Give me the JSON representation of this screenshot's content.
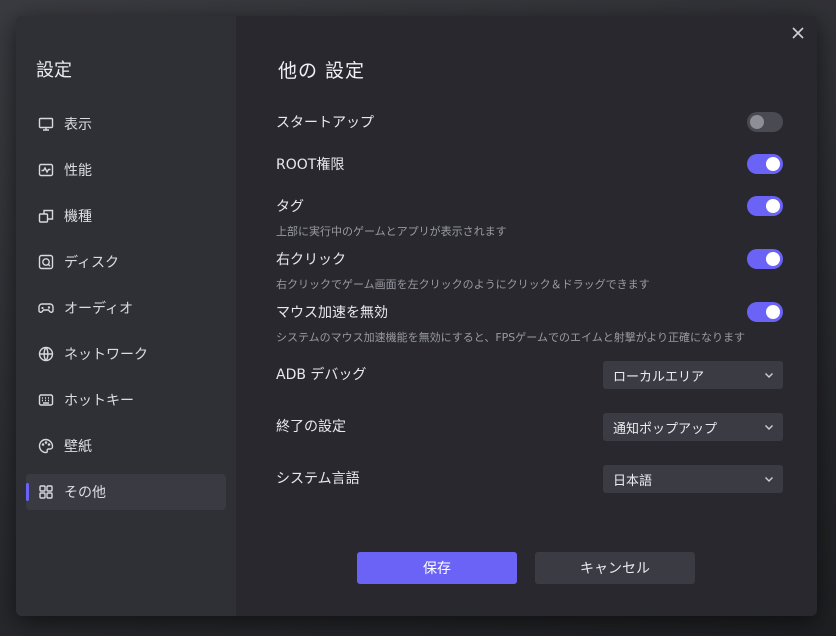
{
  "sidebar": {
    "title": "設定",
    "items": [
      {
        "label": "表示",
        "icon": "monitor-icon"
      },
      {
        "label": "性能",
        "icon": "performance-icon"
      },
      {
        "label": "機種",
        "icon": "device-icon"
      },
      {
        "label": "ディスク",
        "icon": "disk-icon"
      },
      {
        "label": "オーディオ",
        "icon": "gamepad-icon"
      },
      {
        "label": "ネットワーク",
        "icon": "globe-icon"
      },
      {
        "label": "ホットキー",
        "icon": "keyboard-icon"
      },
      {
        "label": "壁紙",
        "icon": "palette-icon"
      },
      {
        "label": "その他",
        "icon": "grid-icon",
        "active": true
      }
    ]
  },
  "main": {
    "title": "他の 設定",
    "settings": {
      "startup": {
        "label": "スタートアップ",
        "enabled": false
      },
      "root": {
        "label": "ROOT権限",
        "enabled": true
      },
      "tag": {
        "label": "タグ",
        "description": "上部に実行中のゲームとアプリが表示されます",
        "enabled": true
      },
      "right_click": {
        "label": "右クリック",
        "description": "右クリックでゲーム画面を左クリックのようにクリック＆ドラッグできます",
        "enabled": true
      },
      "mouse_accel": {
        "label": "マウス加速を無効",
        "description": "システムのマウス加速機能を無効にすると、FPSゲームでのエイムと射撃がより正確になります",
        "enabled": true
      }
    },
    "selects": {
      "adb": {
        "label": "ADB デバッグ",
        "value": "ローカルエリア"
      },
      "exit": {
        "label": "終了の設定",
        "value": "通知ポップアップ"
      },
      "language": {
        "label": "システム言語",
        "value": "日本語"
      }
    }
  },
  "buttons": {
    "save": "保存",
    "cancel": "キャンセル"
  },
  "colors": {
    "accent": "#6b63f6",
    "toggle_off": "#4a4b52",
    "panel": "#28282e",
    "sidebar": "#2f3036"
  }
}
